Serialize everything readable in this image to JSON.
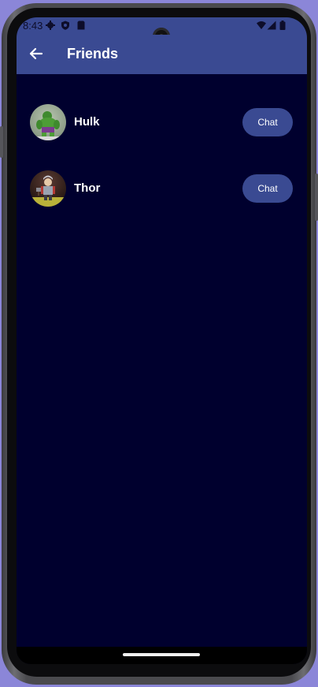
{
  "status_bar": {
    "time": "8:43",
    "icons_left": [
      "settings-icon",
      "shield-icon",
      "sim-card-icon"
    ],
    "icons_right": [
      "wifi-icon",
      "signal-icon",
      "battery-icon"
    ]
  },
  "app_bar": {
    "title": "Friends",
    "back_icon": "arrow-back-icon"
  },
  "friends": [
    {
      "name": "Hulk",
      "chat_label": "Chat"
    },
    {
      "name": "Thor",
      "chat_label": "Chat"
    }
  ],
  "colors": {
    "primary": "#3a4a92",
    "background": "#00002e",
    "text": "#ffffff"
  }
}
